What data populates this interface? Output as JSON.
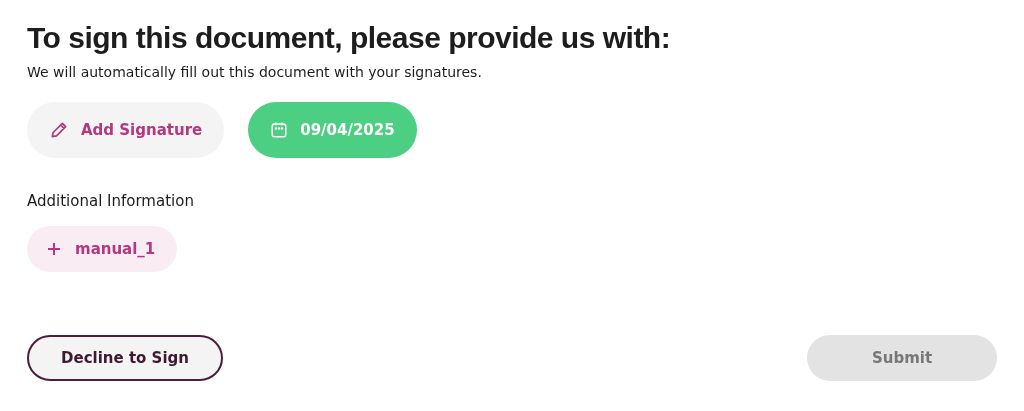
{
  "title": "To sign this document, please provide us with:",
  "subtitle": "We will automatically fill out this document with your signatures.",
  "fields": [
    {
      "kind": "signature",
      "label": "Add Signature",
      "filled": false
    },
    {
      "kind": "date",
      "label": "09/04/2025",
      "filled": true
    }
  ],
  "additional": {
    "heading": "Additional Information",
    "items": [
      {
        "label": "manual_1"
      }
    ]
  },
  "actions": {
    "decline": {
      "label": "Decline to Sign"
    },
    "submit": {
      "label": "Submit",
      "disabled": true
    }
  }
}
